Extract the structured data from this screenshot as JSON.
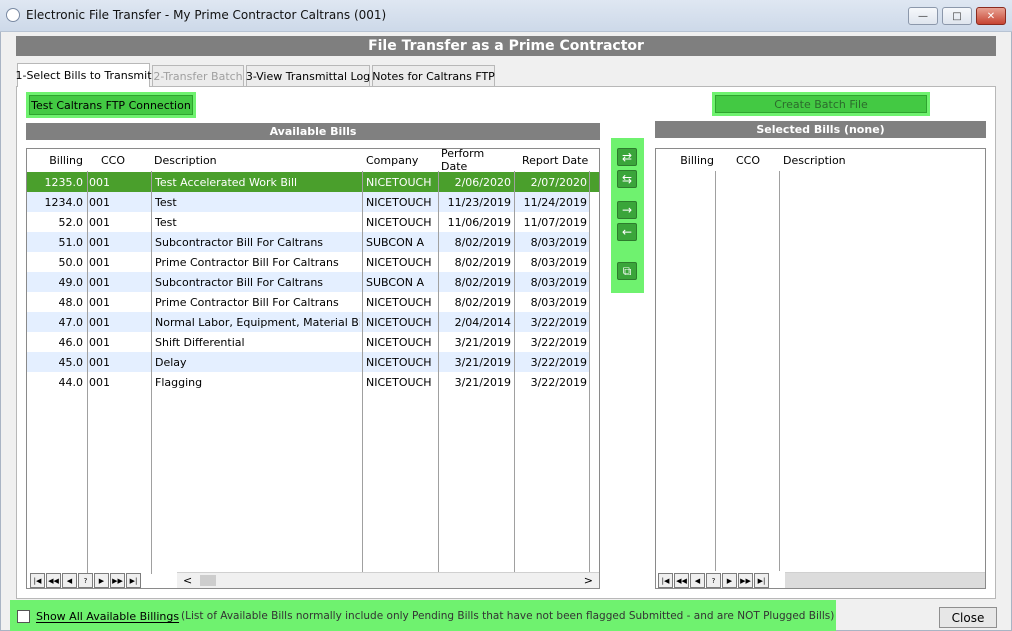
{
  "window": {
    "title": "Electronic File Transfer - My Prime Contractor Caltrans (001)",
    "minimize": "—",
    "maximize": "□",
    "close": "✕"
  },
  "banner": "File Transfer as a Prime Contractor",
  "tabs": [
    {
      "label": "1-Select Bills to Transmit",
      "state": "active"
    },
    {
      "label": "2-Transfer Batch",
      "state": "disabled"
    },
    {
      "label": "3-View Transmittal Log",
      "state": "normal"
    },
    {
      "label": "Notes for Caltrans FTP",
      "state": "normal"
    }
  ],
  "buttons": {
    "test_ftp": "Test Caltrans FTP Connection",
    "create_batch": "Create Batch File",
    "close": "Close"
  },
  "available": {
    "header": "Available Bills",
    "columns": [
      "Billing",
      "CCO",
      "Description",
      "Company",
      "Perform Date",
      "Report Date"
    ],
    "rows": [
      [
        "1235.0",
        "001",
        "Test Accelerated Work Bill",
        "NICETOUCH",
        "2/06/2020",
        "2/07/2020"
      ],
      [
        "1234.0",
        "001",
        "Test",
        "NICETOUCH",
        "11/23/2019",
        "11/24/2019"
      ],
      [
        "52.0",
        "001",
        "Test",
        "NICETOUCH",
        "11/06/2019",
        "11/07/2019"
      ],
      [
        "51.0",
        "001",
        "Subcontractor Bill For Caltrans",
        "SUBCON A",
        "8/02/2019",
        "8/03/2019"
      ],
      [
        "50.0",
        "001",
        "Prime Contractor Bill For Caltrans",
        "NICETOUCH",
        "8/02/2019",
        "8/03/2019"
      ],
      [
        "49.0",
        "001",
        "Subcontractor Bill For Caltrans",
        "SUBCON A",
        "8/02/2019",
        "8/03/2019"
      ],
      [
        "48.0",
        "001",
        "Prime Contractor Bill For Caltrans",
        "NICETOUCH",
        "8/02/2019",
        "8/03/2019"
      ],
      [
        "47.0",
        "001",
        "Normal Labor, Equipment, Material Bill",
        "NICETOUCH",
        "2/04/2014",
        "3/22/2019"
      ],
      [
        "46.0",
        "001",
        "Shift Differential",
        "NICETOUCH",
        "3/21/2019",
        "3/22/2019"
      ],
      [
        "45.0",
        "001",
        "Delay",
        "NICETOUCH",
        "3/21/2019",
        "3/22/2019"
      ],
      [
        "44.0",
        "001",
        "Flagging",
        "NICETOUCH",
        "3/21/2019",
        "3/22/2019"
      ]
    ]
  },
  "selected": {
    "header": "Selected Bills (none)",
    "columns": [
      "Billing",
      "CCO",
      "Description"
    ]
  },
  "navigator": [
    "|◀",
    "◀◀",
    "◀",
    "?",
    "▶",
    "▶▶",
    "▶|"
  ],
  "scroll": {
    "left": "<",
    "right": ">"
  },
  "transfer_controls": {
    "swap": "⇄",
    "swap_all": "⇆",
    "add": "→",
    "remove": "←",
    "copy": "⧉"
  },
  "footer": {
    "show_all_label": "Show All Available Billings",
    "note": "(List of Available Bills normally include only Pending Bills that have not been flagged Submitted - and are NOT Plugged Bills)"
  },
  "colors": {
    "highlight": "#6ff26f",
    "selected_row": "#4a9f2c",
    "alt_row": "#e4efff",
    "section_header": "#808080"
  }
}
